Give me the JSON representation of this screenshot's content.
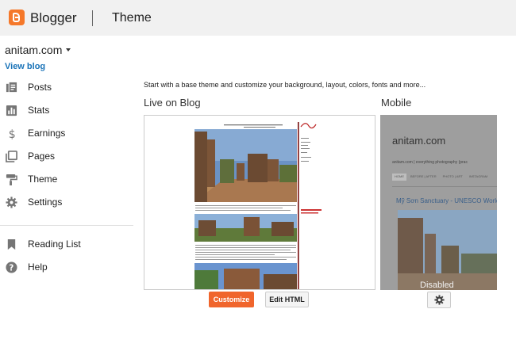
{
  "app": {
    "brand": "Blogger",
    "page_title": "Theme"
  },
  "sidebar": {
    "blog_name": "anitam.com",
    "view_blog": "View blog",
    "items": [
      {
        "label": "Posts",
        "icon": "posts-icon"
      },
      {
        "label": "Stats",
        "icon": "stats-icon"
      },
      {
        "label": "Earnings",
        "icon": "dollar-icon"
      },
      {
        "label": "Pages",
        "icon": "pages-icon"
      },
      {
        "label": "Theme",
        "icon": "paint-roller-icon"
      },
      {
        "label": "Settings",
        "icon": "gear-icon"
      }
    ],
    "secondary": [
      {
        "label": "Reading List",
        "icon": "bookmark-icon"
      },
      {
        "label": "Help",
        "icon": "help-icon"
      }
    ]
  },
  "main": {
    "intro": "Start with a base theme and customize your background, layout, colors, fonts and more...",
    "live_title": "Live on Blog",
    "mobile_title": "Mobile",
    "customize_label": "Customize",
    "edit_html_label": "Edit HTML"
  },
  "mobile_preview": {
    "title": "anitam.com",
    "subtitle": "anitam.com | everything photography (prac",
    "tabs": [
      "HOME",
      "BEFORE | AFTER",
      "PHOTO | ART",
      "INSTAGRAM"
    ],
    "post_title": "Mỹ Sơn Sanctuary - UNESCO World",
    "overlay": "Disabled"
  },
  "colors": {
    "accent": "#f0652c",
    "link": "#1a73b8",
    "topbar": "#f1f1f1"
  }
}
